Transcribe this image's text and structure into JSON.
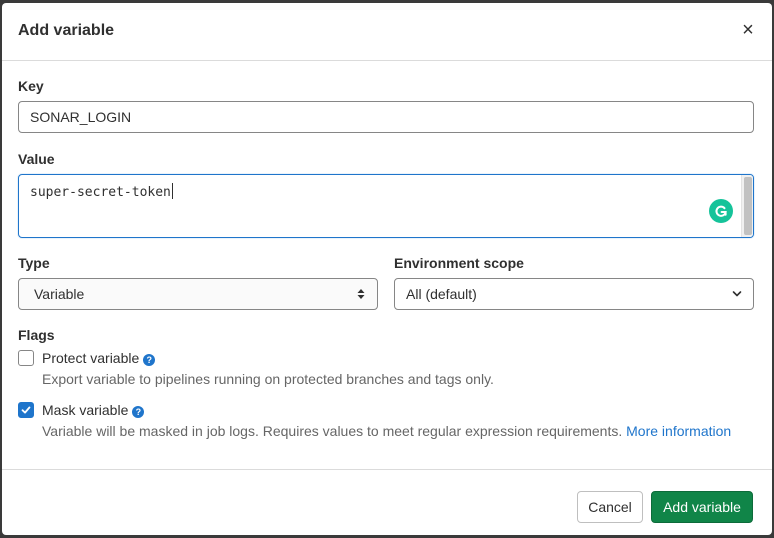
{
  "modal": {
    "title": "Add variable",
    "close_glyph": "×",
    "close_icon": "close-icon"
  },
  "form": {
    "key": {
      "label": "Key",
      "value": "SONAR_LOGIN"
    },
    "value": {
      "label": "Value",
      "value": "super-secret-token",
      "assistant_icon": "grammarly-icon"
    },
    "type": {
      "label": "Type",
      "selected": "Variable",
      "icon": "sort-arrows-icon"
    },
    "environment_scope": {
      "label": "Environment scope",
      "selected": "All (default)",
      "icon": "chevron-down-icon"
    },
    "flags": {
      "label": "Flags",
      "protect": {
        "label": "Protect variable",
        "checked": false,
        "help_glyph": "?",
        "description": "Export variable to pipelines running on protected branches and tags only."
      },
      "mask": {
        "label": "Mask variable",
        "checked": true,
        "help_glyph": "?",
        "description": "Variable will be masked in job logs. Requires values to meet regular expression requirements.",
        "link": "More information"
      }
    }
  },
  "footer": {
    "cancel_label": "Cancel",
    "submit_label": "Add variable"
  },
  "colors": {
    "primary": "#108548",
    "link": "#1f75cb",
    "grammarly": "#15c39a"
  }
}
